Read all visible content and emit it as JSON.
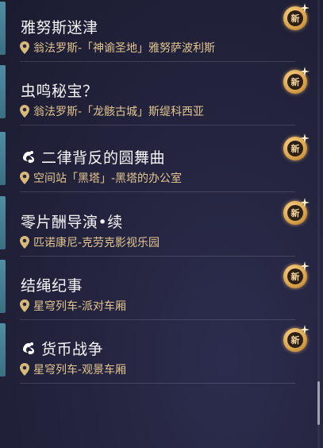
{
  "quests": [
    {
      "title": "雅努斯迷津",
      "location": "翁法罗斯-「神谕圣地」雅努萨波利斯",
      "type_icon": null,
      "badge": "新"
    },
    {
      "title": "虫鸣秘宝？",
      "location": "翁法罗斯-「龙骸古城」斯缇科西亚",
      "type_icon": null,
      "badge": "新"
    },
    {
      "title": "二律背反的圆舞曲",
      "location": "空间站「黑塔」-黑塔的办公室",
      "type_icon": "quest-type-icon",
      "badge": "新"
    },
    {
      "title": "零片酬导演•续",
      "location": "匹诺康尼-克劳克影视乐园",
      "type_icon": null,
      "badge": "新"
    },
    {
      "title": "结绳纪事",
      "location": "星穹列车-派对车厢",
      "type_icon": null,
      "badge": "新"
    },
    {
      "title": "货币战争",
      "location": "星穹列车-观景车厢",
      "type_icon": "quest-type-icon",
      "badge": "新"
    }
  ],
  "colors": {
    "accent": "#4f8ea3",
    "location": "#e2c58f",
    "badge_gold": "#d9a24a",
    "background": "#24243f"
  }
}
